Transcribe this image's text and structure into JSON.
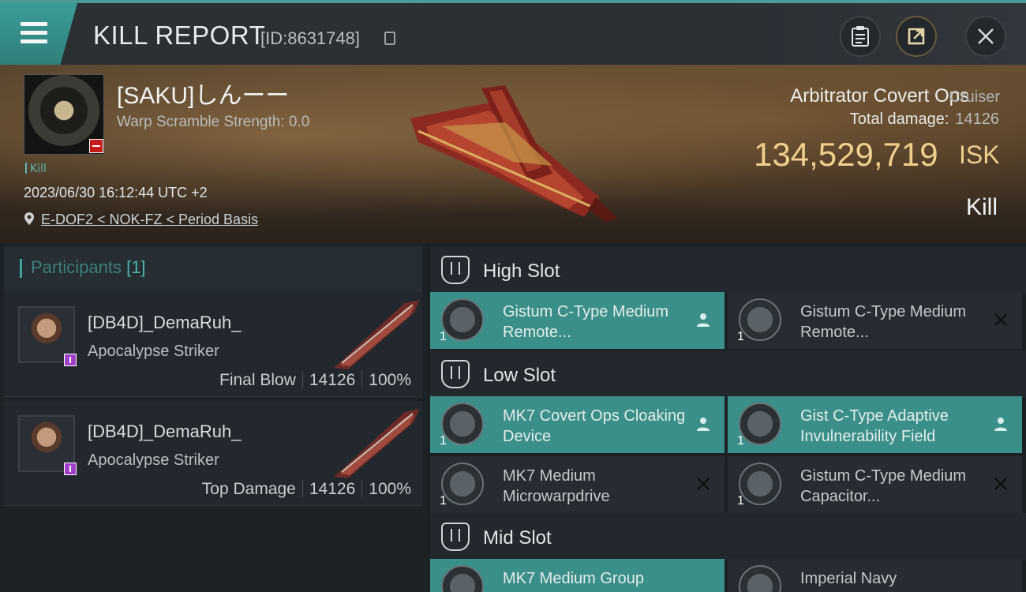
{
  "header": {
    "title": "KILL REPORT",
    "report_id": "[ID:8631748]"
  },
  "victim": {
    "name": "[SAKU]しんーー",
    "warp_scramble": "Warp Scramble Strength: 0.0",
    "tag": "Kill",
    "datetime": "2023/06/30 16:12:44 UTC +2",
    "location": "E-DOF2 < NOK-FZ < Period Basis",
    "ship_name": "Arbitrator Covert Ops",
    "ship_class": "Cruiser",
    "total_damage_label": "Total damage:",
    "total_damage": "14126",
    "isk_value": "134,529,719",
    "isk_unit": "ISK",
    "result": "Kill"
  },
  "participants": {
    "title": "Participants",
    "count": "[1]",
    "items": [
      {
        "name": "[DB4D]_DemaRuh_",
        "ship": "Apocalypse Striker",
        "role": "Final Blow",
        "damage": "14126",
        "percent": "100%"
      },
      {
        "name": "[DB4D]_DemaRuh_",
        "ship": "Apocalypse Striker",
        "role": "Top Damage",
        "damage": "14126",
        "percent": "100%"
      }
    ]
  },
  "slots": {
    "high": {
      "label": "High Slot",
      "modules": [
        {
          "name": "Gistum C-Type Medium Remote...",
          "qty": "1",
          "state": "active"
        },
        {
          "name": "Gistum C-Type Medium Remote...",
          "qty": "1",
          "state": "destroyed"
        }
      ]
    },
    "low": {
      "label": "Low Slot",
      "modules": [
        {
          "name": "MK7 Covert Ops Cloaking Device",
          "qty": "1",
          "state": "active"
        },
        {
          "name": "Gist C-Type Adaptive Invulnerability Field",
          "qty": "1",
          "state": "active"
        },
        {
          "name": "MK7 Medium Microwarpdrive",
          "qty": "1",
          "state": "destroyed"
        },
        {
          "name": "Gistum C-Type Medium Capacitor...",
          "qty": "1",
          "state": "destroyed"
        }
      ]
    },
    "mid": {
      "label": "Mid Slot",
      "modules": [
        {
          "name": "MK7 Medium Group",
          "qty": "1",
          "state": "active"
        },
        {
          "name": "Imperial Navy",
          "qty": "1",
          "state": "destroyed"
        }
      ]
    }
  },
  "colors": {
    "accent": "#3fa39c",
    "isk": "#efcf8c",
    "active_module": "#3a8f89",
    "badge_red": "#c41a1a",
    "badge_purple": "#a040c8"
  }
}
